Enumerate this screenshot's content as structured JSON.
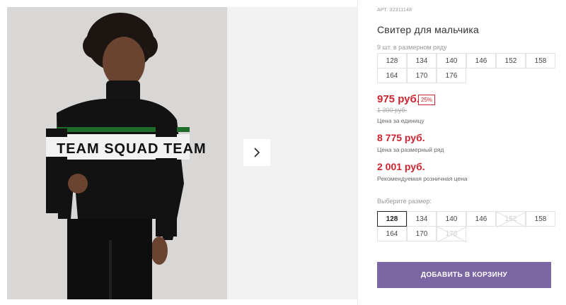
{
  "gallery": {
    "photo_alt": "",
    "sweater_print": "TEAM SQUAD TEAM",
    "next_icon": "chevron-right-icon"
  },
  "product": {
    "article": "АРТ. 32311148",
    "title": "Свитер для мальчика",
    "row_label": "9 шт. в размерном ряду",
    "row_sizes": [
      "128",
      "134",
      "140",
      "146",
      "152",
      "158",
      "164",
      "170",
      "176"
    ]
  },
  "prices": {
    "unit_price": "975 руб.",
    "discount": "25%",
    "old_price": "1 300 руб.",
    "unit_note": "Цена за единицу",
    "row_price": "8 775 руб.",
    "row_note": "Цена за размерный ряд",
    "retail_price": "2 001 руб.",
    "retail_note": "Рекомендуемая розничная цена",
    "accent_color": "#d0232f"
  },
  "size_picker": {
    "label": "Выберите размер:",
    "options": [
      {
        "size": "128",
        "state": "selected"
      },
      {
        "size": "134",
        "state": "available"
      },
      {
        "size": "140",
        "state": "available"
      },
      {
        "size": "146",
        "state": "available"
      },
      {
        "size": "152",
        "state": "disabled"
      },
      {
        "size": "158",
        "state": "available"
      },
      {
        "size": "164",
        "state": "available"
      },
      {
        "size": "170",
        "state": "available"
      },
      {
        "size": "176",
        "state": "disabled"
      }
    ]
  },
  "cart": {
    "add_label": "ДОБАВИТЬ В КОРЗИНУ",
    "button_color": "#7a66a3"
  }
}
